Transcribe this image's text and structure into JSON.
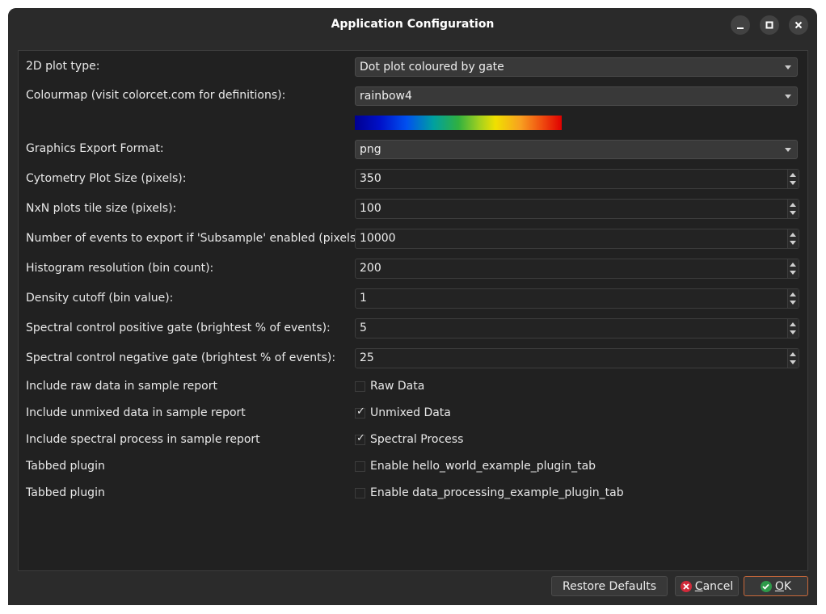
{
  "window": {
    "title": "Application Configuration"
  },
  "fields": {
    "plot_type": {
      "label": "2D plot type:",
      "value": "Dot plot coloured by gate"
    },
    "colourmap": {
      "label": "Colourmap (visit colorcet.com for definitions):",
      "value": "rainbow4"
    },
    "export_format": {
      "label": "Graphics Export Format:",
      "value": "png"
    },
    "plot_size": {
      "label": "Cytometry Plot Size (pixels):",
      "value": "350"
    },
    "tile_size": {
      "label": "NxN plots tile size (pixels):",
      "value": "100"
    },
    "export_events": {
      "label": "Number of events to export if 'Subsample' enabled (pixels):",
      "value": "10000"
    },
    "histogram_res": {
      "label": "Histogram resolution (bin count):",
      "value": "200"
    },
    "density_cutoff": {
      "label": "Density cutoff (bin value):",
      "value": "1"
    },
    "pos_gate": {
      "label": "Spectral control positive gate (brightest % of events):",
      "value": "5"
    },
    "neg_gate": {
      "label": "Spectral control negative gate (brightest % of events):",
      "value": "25"
    }
  },
  "checkboxes": [
    {
      "label": "Include raw data in sample report",
      "text": "Raw Data",
      "checked": false
    },
    {
      "label": "Include unmixed data in sample report",
      "text": "Unmixed Data",
      "checked": true
    },
    {
      "label": "Include spectral process in sample report",
      "text": "Spectral Process",
      "checked": true
    },
    {
      "label": "Tabbed plugin",
      "text": "Enable hello_world_example_plugin_tab",
      "checked": false
    },
    {
      "label": "Tabbed plugin",
      "text": "Enable data_processing_example_plugin_tab",
      "checked": false
    }
  ],
  "check_mark": "✓",
  "buttons": {
    "restore_defaults": "Restore Defaults",
    "cancel_underlined": "C",
    "cancel_rest": "ancel",
    "ok_underlined": "O",
    "ok_rest": "K"
  },
  "icons": {
    "minimize": "minimize-icon",
    "maximize": "maximize-icon",
    "close": "close-icon",
    "cancel": "cancel-x-icon",
    "ok": "checkmark-icon"
  },
  "colors": {
    "window_bg": "#2b2b2b",
    "panel_bg": "#212121",
    "cancel_icon": "#d12a3a",
    "ok_icon": "#2e9a4a",
    "ok_border": "#c9683a"
  }
}
